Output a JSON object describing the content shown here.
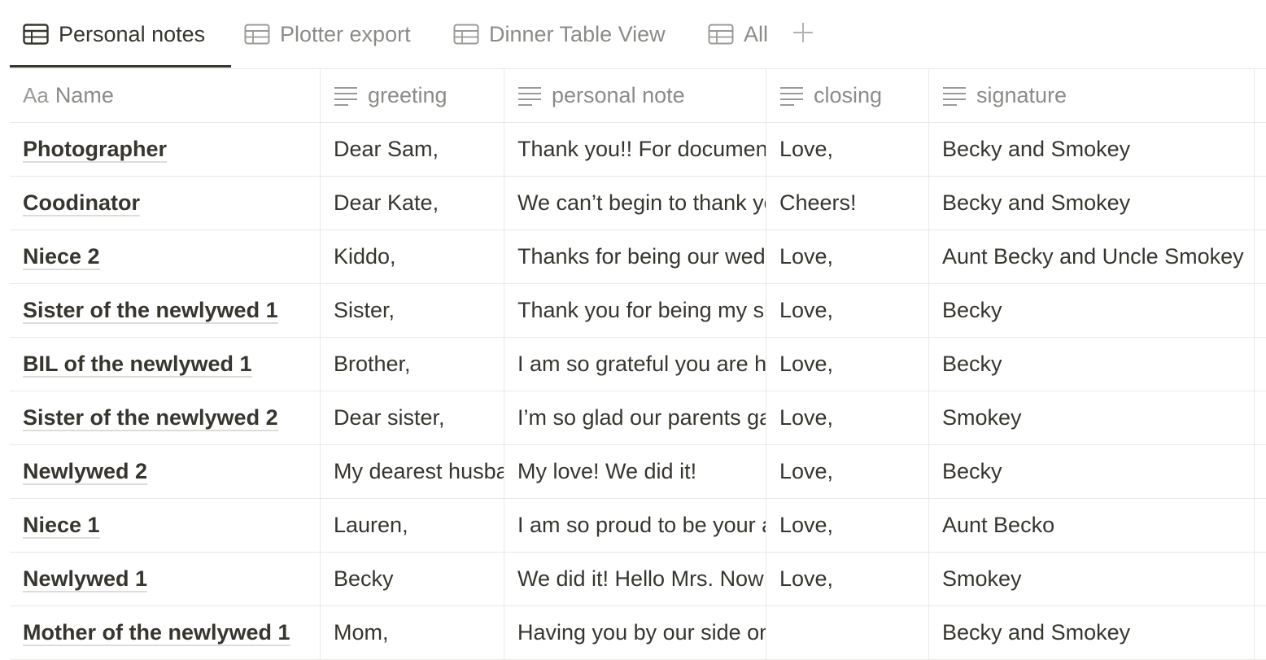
{
  "tabs": [
    {
      "label": "Personal notes",
      "active": true
    },
    {
      "label": "Plotter export",
      "active": false
    },
    {
      "label": "Dinner Table View",
      "active": false
    },
    {
      "label": "All",
      "active": false
    }
  ],
  "add_view_icon": "plus-icon",
  "columns": {
    "name": {
      "icon": "Aa",
      "label": "Name"
    },
    "greeting": {
      "icon": "text-lines-icon",
      "label": "greeting"
    },
    "personal_note": {
      "icon": "text-lines-icon",
      "label": "personal note"
    },
    "closing": {
      "icon": "text-lines-icon",
      "label": "closing"
    },
    "signature": {
      "icon": "text-lines-icon",
      "label": "signature"
    }
  },
  "rows": [
    {
      "name": "Photographer",
      "greeting": "Dear Sam,",
      "personal_note": "Thank you!! For documenting our day",
      "closing": "Love,",
      "signature": "Becky and Smokey"
    },
    {
      "name": "Coodinator",
      "greeting": "Dear Kate,",
      "personal_note": "We can’t begin to thank you",
      "closing": "Cheers!",
      "signature": "Becky and Smokey"
    },
    {
      "name": "Niece 2",
      "greeting": "Kiddo,",
      "personal_note": "Thanks for being our wedding helper",
      "closing": "Love,",
      "signature": "Aunt Becky and Uncle Smokey"
    },
    {
      "name": "Sister of the newlywed 1",
      "greeting": "Sister,",
      "personal_note": "Thank you for being my sister",
      "closing": "Love,",
      "signature": "Becky"
    },
    {
      "name": "BIL of the newlywed 1",
      "greeting": "Brother,",
      "personal_note": "I am so grateful you are here",
      "closing": "Love,",
      "signature": "Becky"
    },
    {
      "name": "Sister of the newlywed 2",
      "greeting": "Dear sister,",
      "personal_note": "I’m so glad our parents gave me you",
      "closing": "Love,",
      "signature": "Smokey"
    },
    {
      "name": "Newlywed 2",
      "greeting": "My dearest husband,",
      "personal_note": "My love! We did it!",
      "closing": "Love,",
      "signature": "Becky"
    },
    {
      "name": "Niece 1",
      "greeting": "Lauren,",
      "personal_note": "I am so proud to be your aunt",
      "closing": "Love,",
      "signature": "Aunt Becko"
    },
    {
      "name": "Newlywed 1",
      "greeting": "Becky",
      "personal_note": "We did it! Hello Mrs. Now",
      "closing": "Love,",
      "signature": "Smokey"
    },
    {
      "name": "Mother of the newlywed 1",
      "greeting": "Mom,",
      "personal_note": "Having you by our side on this day",
      "closing": "",
      "signature": "Becky and Smokey"
    }
  ]
}
